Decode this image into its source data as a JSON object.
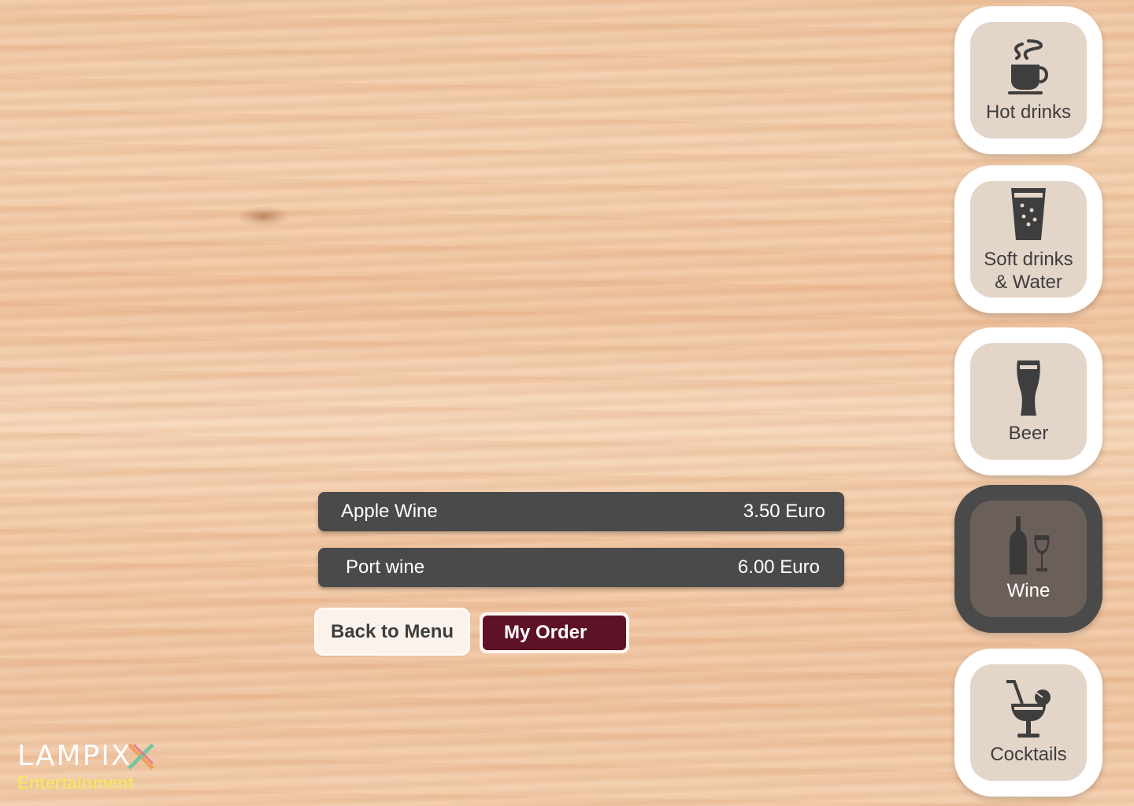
{
  "categories": [
    {
      "label": "Hot drinks",
      "icon": "coffee-cup-icon",
      "active": false
    },
    {
      "label": "Soft drinks\n& Water",
      "icon": "water-glass-icon",
      "active": false
    },
    {
      "label": "Beer",
      "icon": "beer-glass-icon",
      "active": false
    },
    {
      "label": "Wine",
      "icon": "wine-bottle-glass-icon",
      "active": true
    },
    {
      "label": "Cocktails",
      "icon": "cocktail-glass-icon",
      "active": false
    }
  ],
  "menu_items": [
    {
      "name": "Apple Wine",
      "price": "3.50 Euro"
    },
    {
      "name": "Port wine",
      "price": "6.00 Euro"
    }
  ],
  "actions": {
    "back_label": "Back to Menu",
    "order_label": "My Order"
  },
  "logo": {
    "word": "LAMPIX",
    "sub": "Entertainment"
  },
  "colors": {
    "active_category": "#4a4a4a",
    "item_bar": "#4a4a4a",
    "order_button": "#5e1227",
    "logo_sub": "#f5e36a"
  }
}
